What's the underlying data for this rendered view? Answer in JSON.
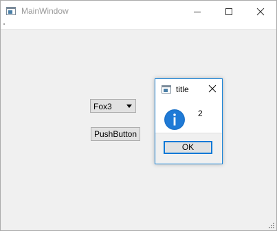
{
  "main_window": {
    "title": "MainWindow",
    "icon": "app-window-icon",
    "controls": [
      "minimize-icon",
      "maximize-icon",
      "close-icon"
    ]
  },
  "central": {
    "combo": {
      "selected": "Fox3",
      "icon": "chevron-down-icon"
    },
    "push_button": {
      "label": "PushButton"
    }
  },
  "dialog": {
    "title": "title",
    "icon": "app-window-icon",
    "message": "2",
    "info_icon": "info-icon",
    "ok_label": "OK",
    "accent_color": "#0078d7"
  }
}
